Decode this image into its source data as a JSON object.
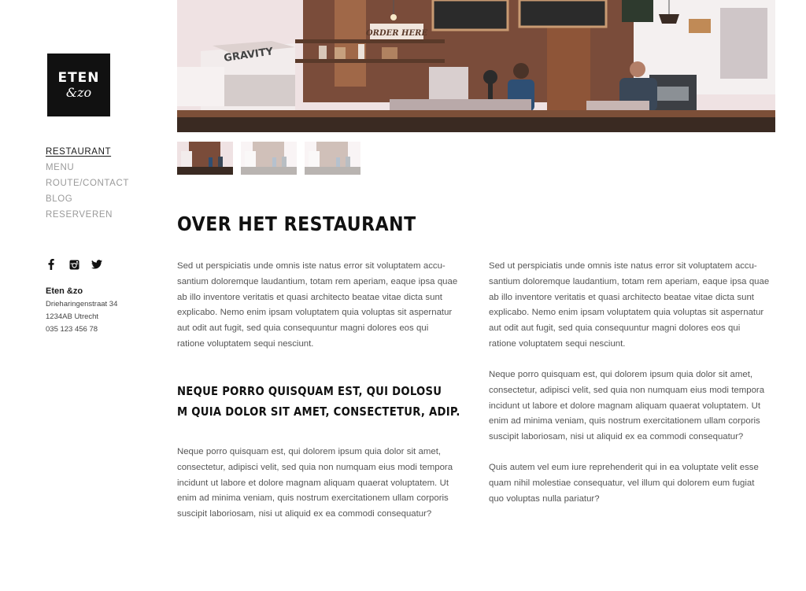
{
  "logo": {
    "line1": "ETEN",
    "line2": "&zo"
  },
  "nav": {
    "items": [
      {
        "label": "RESTAURANT",
        "active": true
      },
      {
        "label": "MENU"
      },
      {
        "label": "ROUTE/CONTACT"
      },
      {
        "label": "BLOG"
      },
      {
        "label": "RESERVEREN"
      }
    ]
  },
  "social": {
    "icons": [
      "facebook-icon",
      "instagram-icon",
      "twitter-icon"
    ]
  },
  "address": {
    "name": "Eten &zo",
    "street": "Drieharingenstraat 34",
    "city": "1234AB Utrecht",
    "phone": "035 123 456 78"
  },
  "hero": {
    "sign_order": "ORDER HERE",
    "sign_gravity": "GRAVITY",
    "thumbnails": 3,
    "active_thumbnail": 1
  },
  "content": {
    "title": "OVER HET RESTAURANT",
    "subtitle_line1": "NEQUE PORRO QUISQUAM EST, QUI DOLOSU",
    "subtitle_line2": "M QUIA DOLOR SIT AMET, CONSECTETUR, ADIP.",
    "left": {
      "p1": [
        "Sed ut perspiciatis unde omnis iste natus error sit voluptatem accu-",
        "santium doloremque laudantium, totam rem aperiam, eaque ipsa quae",
        "ab illo inventore veritatis et quasi architecto beatae vitae dicta sunt",
        "explicabo. Nemo enim ipsam voluptatem quia voluptas sit aspernatur",
        "aut odit aut fugit, sed quia consequuntur magni dolores eos qui",
        "ratione voluptatem sequi nesciunt."
      ],
      "p2": [
        "Neque porro quisquam est, qui dolorem ipsum quia dolor sit amet,",
        "consectetur, adipisci velit, sed quia non numquam eius modi tempora",
        "incidunt ut labore et dolore magnam aliquam quaerat voluptatem. Ut",
        "enim ad minima veniam, quis nostrum exercitationem ullam corporis",
        "suscipit laboriosam, nisi ut aliquid ex ea commodi consequatur?"
      ]
    },
    "right": {
      "p1": [
        "Sed ut perspiciatis unde omnis iste natus error sit voluptatem accu-",
        "santium doloremque laudantium, totam rem aperiam, eaque ipsa quae",
        "ab illo inventore veritatis et quasi architecto beatae vitae dicta sunt",
        "explicabo. Nemo enim ipsam voluptatem quia voluptas sit aspernatur",
        "aut odit aut fugit, sed quia consequuntur magni dolores eos qui",
        "ratione voluptatem sequi nesciunt."
      ],
      "p2": [
        "Neque porro quisquam est, qui dolorem ipsum quia dolor sit amet,",
        "consectetur, adipisci velit, sed quia non numquam eius modi tempora",
        "incidunt ut labore et dolore magnam aliquam quaerat voluptatem. Ut",
        "enim ad minima veniam, quis nostrum exercitationem ullam corporis",
        "suscipit laboriosam, nisi ut aliquid ex ea commodi consequatur?"
      ],
      "p3": [
        "Quis autem vel eum iure reprehenderit qui in ea voluptate velit esse",
        "quam nihil molestiae consequatur, vel illum qui dolorem eum fugiat",
        "quo voluptas nulla pariatur?"
      ]
    }
  },
  "colors": {
    "text": "#555555",
    "heading": "#111111",
    "nav_inactive": "#9a9a9a",
    "logo_bg": "#111111"
  }
}
